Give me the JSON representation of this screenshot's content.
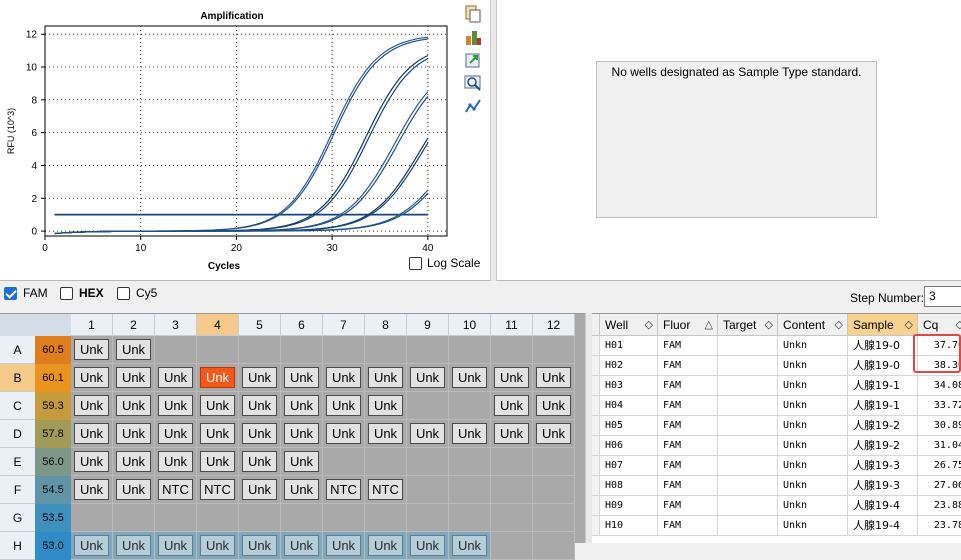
{
  "chart_data": {
    "type": "line",
    "title": "Amplification",
    "xlabel": "Cycles",
    "ylabel": "RFU (10^3)",
    "xlim": [
      0,
      42
    ],
    "ylim": [
      -0.3,
      12.5
    ],
    "xticks": [
      0,
      10,
      20,
      30,
      40
    ],
    "yticks": [
      0,
      2,
      4,
      6,
      8,
      10,
      12
    ],
    "grid": true,
    "series": [
      {
        "x": [
          1,
          40
        ],
        "values": [
          1.0,
          1.0
        ],
        "kind": "flat",
        "mid": 0,
        "max": 0
      },
      {
        "x": [
          1,
          40
        ],
        "values": [
          1.0,
          1.0
        ],
        "kind": "flat",
        "mid": 0,
        "max": 0
      },
      {
        "kind": "sigmoid",
        "mid": 30.0,
        "max": 12.0,
        "slope": 0.42
      },
      {
        "kind": "sigmoid",
        "mid": 30.2,
        "max": 11.9,
        "slope": 0.42
      },
      {
        "kind": "sigmoid",
        "mid": 33.5,
        "max": 11.4,
        "slope": 0.42
      },
      {
        "kind": "sigmoid",
        "mid": 33.8,
        "max": 11.3,
        "slope": 0.42
      },
      {
        "kind": "sigmoid",
        "mid": 36.5,
        "max": 10.6,
        "slope": 0.4
      },
      {
        "kind": "sigmoid",
        "mid": 36.8,
        "max": 10.5,
        "slope": 0.4
      },
      {
        "kind": "sigmoid",
        "mid": 39.2,
        "max": 9.8,
        "slope": 0.4
      },
      {
        "kind": "sigmoid",
        "mid": 39.4,
        "max": 9.6,
        "slope": 0.4
      },
      {
        "kind": "sigmoid",
        "mid": 42.5,
        "max": 9.0,
        "slope": 0.38
      },
      {
        "kind": "sigmoid",
        "mid": 42.8,
        "max": 9.0,
        "slope": 0.38
      }
    ]
  },
  "side_icons": [
    "copy-icon",
    "chart-settings-icon",
    "export-icon",
    "zoom-icon",
    "trace-icon"
  ],
  "log_scale_label": "Log Scale",
  "std_message": "No wells designated as Sample Type standard.",
  "fluors": [
    {
      "name": "FAM",
      "checked": true,
      "bold": false
    },
    {
      "name": "HEX",
      "checked": false,
      "bold": true
    },
    {
      "name": "Cy5",
      "checked": false,
      "bold": false
    }
  ],
  "step": {
    "label": "Step Number:",
    "value": "3"
  },
  "plate": {
    "columns": [
      "1",
      "2",
      "3",
      "4",
      "5",
      "6",
      "7",
      "8",
      "9",
      "10",
      "11",
      "12"
    ],
    "highlight_col": "4",
    "highlight_row": "B",
    "rows": [
      {
        "row": "A",
        "temp": "60.5",
        "temp_color": "#e07d1d",
        "wells": [
          "Unk",
          "Unk",
          "",
          "",
          "",
          "",
          "",
          "",
          "",
          "",
          "",
          ""
        ]
      },
      {
        "row": "B",
        "temp": "60.1",
        "temp_color": "#e8941f",
        "wells": [
          "Unk",
          "Unk",
          "Unk",
          "Unk",
          "Unk",
          "Unk",
          "Unk",
          "Unk",
          "Unk",
          "Unk",
          "Unk",
          "Unk"
        ]
      },
      {
        "row": "C",
        "temp": "59.3",
        "temp_color": "#c59b3c",
        "wells": [
          "Unk",
          "Unk",
          "Unk",
          "Unk",
          "Unk",
          "Unk",
          "Unk",
          "Unk",
          "",
          "",
          "Unk",
          "Unk"
        ]
      },
      {
        "row": "D",
        "temp": "57.8",
        "temp_color": "#a49a57",
        "wells": [
          "Unk",
          "Unk",
          "Unk",
          "Unk",
          "Unk",
          "Unk",
          "Unk",
          "Unk",
          "Unk",
          "Unk",
          "Unk",
          "Unk"
        ]
      },
      {
        "row": "E",
        "temp": "56.0",
        "temp_color": "#7d9888",
        "wells": [
          "Unk",
          "Unk",
          "Unk",
          "Unk",
          "Unk",
          "Unk",
          "",
          "",
          "",
          "",
          "",
          ""
        ]
      },
      {
        "row": "F",
        "temp": "54.5",
        "temp_color": "#5f95a6",
        "wells": [
          "Unk",
          "Unk",
          "NTC",
          "NTC",
          "Unk",
          "Unk",
          "NTC",
          "NTC",
          "",
          "",
          "",
          ""
        ]
      },
      {
        "row": "G",
        "temp": "53.5",
        "temp_color": "#3e90bd",
        "wells": [
          "",
          "",
          "",
          "",
          "",
          "",
          "",
          "",
          "",
          "",
          "",
          ""
        ]
      },
      {
        "row": "H",
        "temp": "53.0",
        "temp_color": "#2f8cc6",
        "wells": [
          "Unk",
          "Unk",
          "Unk",
          "Unk",
          "Unk",
          "Unk",
          "Unk",
          "Unk",
          "Unk",
          "Unk",
          "",
          ""
        ]
      }
    ]
  },
  "results": {
    "columns": [
      "Well",
      "Fluor",
      "Target",
      "Content",
      "Sample",
      "Cq"
    ],
    "highlight_col": "Sample",
    "rows": [
      {
        "well": "H01",
        "fluor": "FAM",
        "target": "",
        "content": "Unkn",
        "sample": "人腺19-0",
        "cq": "37.70"
      },
      {
        "well": "H02",
        "fluor": "FAM",
        "target": "",
        "content": "Unkn",
        "sample": "人腺19-0",
        "cq": "38.30"
      },
      {
        "well": "H03",
        "fluor": "FAM",
        "target": "",
        "content": "Unkn",
        "sample": "人腺19-1",
        "cq": "34.08"
      },
      {
        "well": "H04",
        "fluor": "FAM",
        "target": "",
        "content": "Unkn",
        "sample": "人腺19-1",
        "cq": "33.72"
      },
      {
        "well": "H05",
        "fluor": "FAM",
        "target": "",
        "content": "Unkn",
        "sample": "人腺19-2",
        "cq": "30.89"
      },
      {
        "well": "H06",
        "fluor": "FAM",
        "target": "",
        "content": "Unkn",
        "sample": "人腺19-2",
        "cq": "31.04"
      },
      {
        "well": "H07",
        "fluor": "FAM",
        "target": "",
        "content": "Unkn",
        "sample": "人腺19-3",
        "cq": "26.75"
      },
      {
        "well": "H08",
        "fluor": "FAM",
        "target": "",
        "content": "Unkn",
        "sample": "人腺19-3",
        "cq": "27.06"
      },
      {
        "well": "H09",
        "fluor": "FAM",
        "target": "",
        "content": "Unkn",
        "sample": "人腺19-4",
        "cq": "23.88"
      },
      {
        "well": "H10",
        "fluor": "FAM",
        "target": "",
        "content": "Unkn",
        "sample": "人腺19-4",
        "cq": "23.78"
      }
    ]
  }
}
